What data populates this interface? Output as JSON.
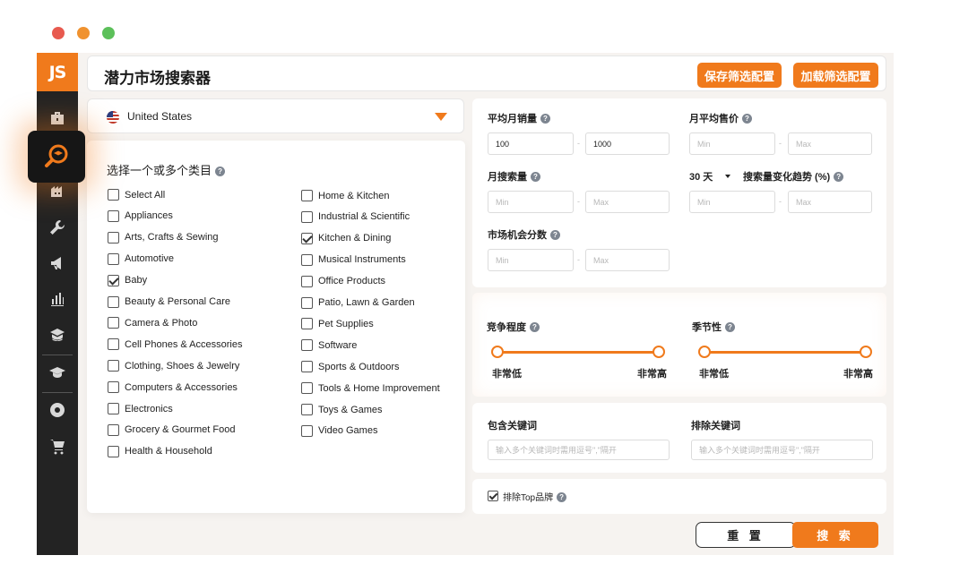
{
  "window_controls": [
    "close",
    "minimize",
    "maximize"
  ],
  "brand": {
    "logo": "JS",
    "accent": "#f07a1c",
    "sidebar_bg": "#232323"
  },
  "sidebar": {
    "items": [
      {
        "icon": "briefcase-icon"
      },
      {
        "icon": "magnifier-icon",
        "active": true
      },
      {
        "icon": "building-icon"
      },
      {
        "icon": "wrench-icon"
      },
      {
        "icon": "megaphone-icon"
      },
      {
        "icon": "bar-chart-icon"
      },
      {
        "icon": "mortarboard-stack-icon"
      },
      {
        "icon": "graduation-cap-icon"
      },
      {
        "icon": "chrome-icon"
      },
      {
        "icon": "cart-icon"
      }
    ]
  },
  "header": {
    "title": "潜力市场搜索器",
    "save_label": "保存筛选配置",
    "load_label": "加载筛选配置"
  },
  "country": {
    "selected": "United States"
  },
  "categories": {
    "title": "选择一个或多个类目",
    "left": [
      {
        "label": "Select All",
        "checked": false
      },
      {
        "label": "Appliances",
        "checked": false
      },
      {
        "label": "Arts, Crafts & Sewing",
        "checked": false
      },
      {
        "label": "Automotive",
        "checked": false
      },
      {
        "label": "Baby",
        "checked": true
      },
      {
        "label": "Beauty & Personal Care",
        "checked": false
      },
      {
        "label": "Camera & Photo",
        "checked": false
      },
      {
        "label": "Cell Phones & Accessories",
        "checked": false
      },
      {
        "label": "Clothing, Shoes & Jewelry",
        "checked": false
      },
      {
        "label": "Computers & Accessories",
        "checked": false
      },
      {
        "label": "Electronics",
        "checked": false
      },
      {
        "label": "Grocery & Gourmet Food",
        "checked": false
      },
      {
        "label": "Health & Household",
        "checked": false
      }
    ],
    "right": [
      {
        "label": "Home & Kitchen",
        "checked": false
      },
      {
        "label": "Industrial & Scientific",
        "checked": false
      },
      {
        "label": "Kitchen & Dining",
        "checked": true
      },
      {
        "label": "Musical Instruments",
        "checked": false
      },
      {
        "label": "Office Products",
        "checked": false
      },
      {
        "label": "Patio, Lawn & Garden",
        "checked": false
      },
      {
        "label": "Pet Supplies",
        "checked": false
      },
      {
        "label": "Software",
        "checked": false
      },
      {
        "label": "Sports & Outdoors",
        "checked": false
      },
      {
        "label": "Tools & Home Improvement",
        "checked": false
      },
      {
        "label": "Toys & Games",
        "checked": false
      },
      {
        "label": "Video Games",
        "checked": false
      }
    ]
  },
  "filters": {
    "monthly_sales": {
      "label": "平均月销量",
      "min_value": "100",
      "max_value": "1000"
    },
    "avg_price": {
      "label": "月平均售价",
      "min_placeholder": "Min",
      "max_placeholder": "Max"
    },
    "search_volume": {
      "label": "月搜索量",
      "min_placeholder": "Min",
      "max_placeholder": "Max"
    },
    "trend": {
      "period": "30 天",
      "label": "搜索量变化趋势 (%)",
      "min_placeholder": "Min",
      "max_placeholder": "Max"
    },
    "opportunity": {
      "label": "市场机会分数",
      "min_placeholder": "Min",
      "max_placeholder": "Max"
    },
    "range_sep": "-"
  },
  "sliders": {
    "competition": {
      "label": "竞争程度",
      "low": "非常低",
      "high": "非常高",
      "min": 0,
      "max": 1
    },
    "seasonality": {
      "label": "季节性",
      "low": "非常低",
      "high": "非常高",
      "min": 0,
      "max": 1
    }
  },
  "keywords": {
    "include_label": "包含关键词",
    "include_placeholder": "输入多个关键词时需用逗号\",\"隔开",
    "exclude_label": "排除关键词",
    "exclude_placeholder": "输入多个关键词时需用逗号\",\"隔开"
  },
  "exclude_top": {
    "label": "排除Top品牌",
    "checked": true
  },
  "actions": {
    "reset": "重 置",
    "search": "搜 索"
  },
  "help_glyph": "?"
}
